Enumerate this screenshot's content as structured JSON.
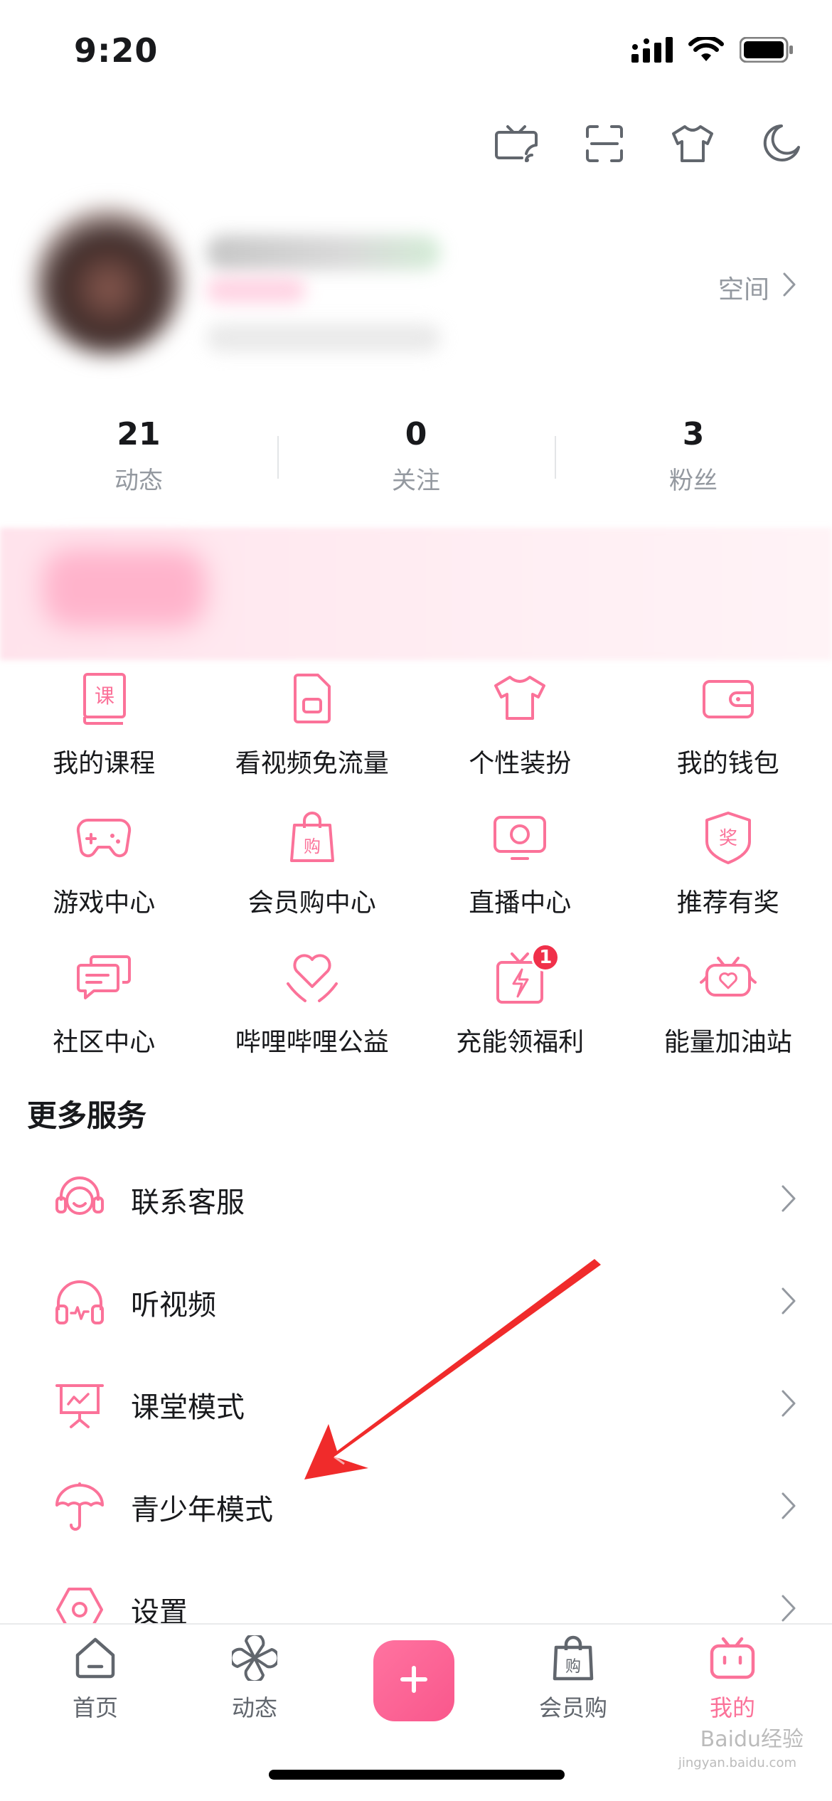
{
  "status_bar": {
    "time": "9:20"
  },
  "top_actions": [
    {
      "name": "tv-cast-icon"
    },
    {
      "name": "scan-icon"
    },
    {
      "name": "tshirt-icon"
    },
    {
      "name": "moon-icon"
    }
  ],
  "profile": {
    "space_label": "空间"
  },
  "stats": [
    {
      "value": "21",
      "label": "动态"
    },
    {
      "value": "0",
      "label": "关注"
    },
    {
      "value": "3",
      "label": "粉丝"
    }
  ],
  "grid": [
    {
      "label": "我的课程",
      "icon": "course-icon"
    },
    {
      "label": "看视频免流量",
      "icon": "sim-card-icon"
    },
    {
      "label": "个性装扮",
      "icon": "tshirt-icon"
    },
    {
      "label": "我的钱包",
      "icon": "wallet-icon"
    },
    {
      "label": "游戏中心",
      "icon": "gamepad-icon"
    },
    {
      "label": "会员购中心",
      "icon": "shopping-bag-icon"
    },
    {
      "label": "直播中心",
      "icon": "live-tv-icon"
    },
    {
      "label": "推荐有奖",
      "icon": "reward-icon"
    },
    {
      "label": "社区中心",
      "icon": "chat-icon"
    },
    {
      "label": "哔哩哔哩公益",
      "icon": "heart-hands-icon"
    },
    {
      "label": "充能领福利",
      "icon": "gift-charge-icon",
      "badge": "1"
    },
    {
      "label": "能量加油站",
      "icon": "energy-tv-icon"
    }
  ],
  "more_services": {
    "title": "更多服务",
    "items": [
      {
        "label": "联系客服",
        "icon": "headset-smile-icon"
      },
      {
        "label": "听视频",
        "icon": "headphones-icon"
      },
      {
        "label": "课堂模式",
        "icon": "presentation-board-icon"
      },
      {
        "label": "青少年模式",
        "icon": "umbrella-icon"
      },
      {
        "label": "设置",
        "icon": "settings-hex-icon"
      }
    ]
  },
  "tab_bar": {
    "tabs": [
      {
        "label": "首页",
        "icon": "home-icon"
      },
      {
        "label": "动态",
        "icon": "pinwheel-icon"
      },
      {
        "label": "",
        "icon": "plus-icon"
      },
      {
        "label": "会员购",
        "icon": "shopping-bag-icon"
      },
      {
        "label": "我的",
        "icon": "bilibili-tv-icon",
        "active": true
      }
    ]
  },
  "watermark": {
    "text": "Baidu经验",
    "sub": "jingyan.baidu.com"
  },
  "colors": {
    "accent": "#fb7299",
    "text": "#18191c",
    "muted": "#9499a0",
    "arrow": "#f02b2b"
  }
}
